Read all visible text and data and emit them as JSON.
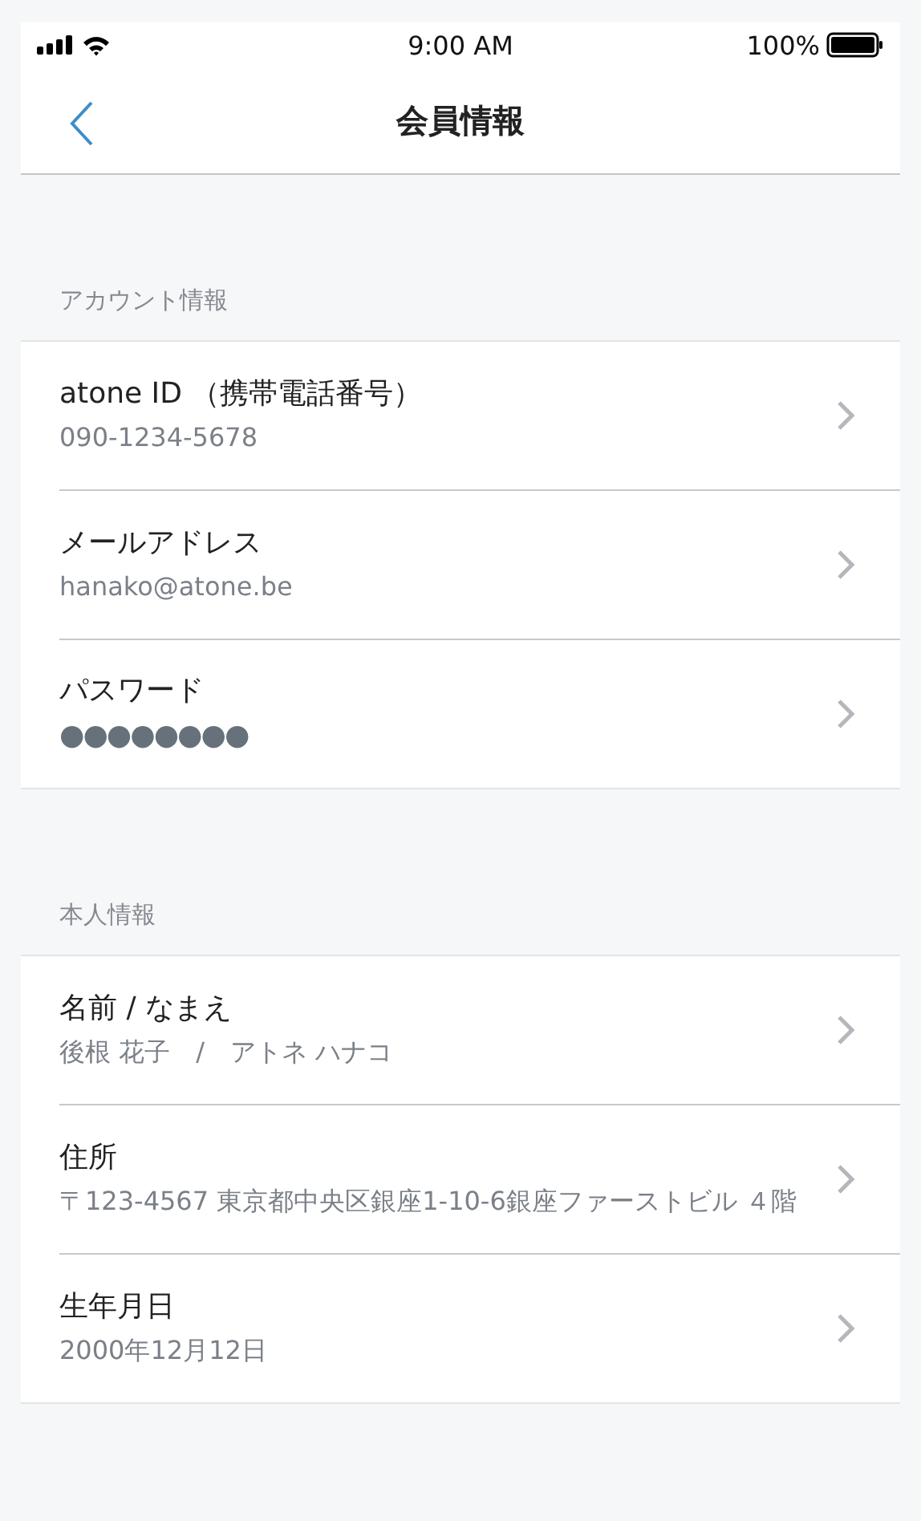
{
  "status_bar": {
    "time": "9:00 AM",
    "battery": "100%"
  },
  "nav": {
    "title": "会員情報"
  },
  "sections": [
    {
      "heading": "アカウント情報",
      "items": [
        {
          "kind": "text",
          "label": "atone ID （携帯電話番号）",
          "value": "090-1234-5678"
        },
        {
          "kind": "text",
          "label": "メールアドレス",
          "value": "hanako@atone.be"
        },
        {
          "kind": "masked",
          "label": "パスワード",
          "value": "●●●●●●●●"
        }
      ]
    },
    {
      "heading": "本人情報",
      "items": [
        {
          "kind": "text",
          "label": "名前 / なまえ",
          "value": "後根 花子　/　アトネ ハナコ"
        },
        {
          "kind": "text",
          "label": "住所",
          "value": "〒123-4567 東京都中央区銀座1-10-6銀座ファーストビル ４階"
        },
        {
          "kind": "text",
          "label": "生年月日",
          "value": "2000年12月12日"
        }
      ]
    }
  ]
}
